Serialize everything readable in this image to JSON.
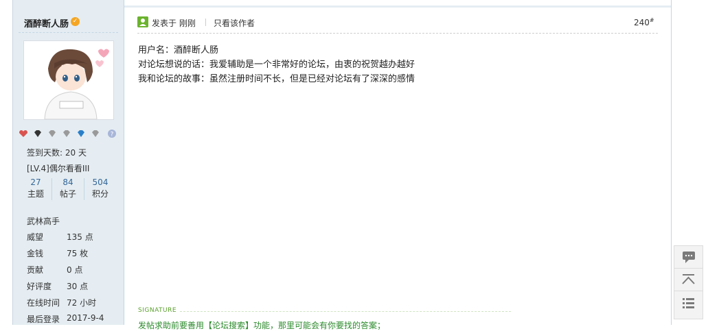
{
  "author": {
    "name": "酒醉断人肠",
    "signin_days": "签到天数: 20 天",
    "level": "[LV.4]偶尔看看III",
    "counts": [
      {
        "value": "27",
        "label": "主题"
      },
      {
        "value": "84",
        "label": "帖子"
      },
      {
        "value": "504",
        "label": "积分"
      }
    ],
    "rank": "武林高手",
    "info": [
      {
        "key": "威望",
        "value": "135 点"
      },
      {
        "key": "金钱",
        "value": "75 枚"
      },
      {
        "key": "贡献",
        "value": "0 点"
      },
      {
        "key": "好评度",
        "value": "30 点"
      },
      {
        "key": "在线时间",
        "value": "72 小时"
      },
      {
        "key": "最后登录",
        "value": "2017-9-4"
      }
    ],
    "medals": [
      "heart-medal-icon",
      "gem-medal-icon",
      "diamond-medal-icon",
      "diamond-medal-icon",
      "blue-gem-medal-icon",
      "diamond-medal-icon",
      "question-medal-icon"
    ]
  },
  "post": {
    "posted_prefix": "发表于",
    "posted_time": "刚刚",
    "only_author": "只看该作者",
    "floor": "240",
    "floor_sup": "#",
    "lines": [
      "用户名：酒醉断人肠",
      "对论坛想说的话：我爱辅助是一个非常好的论坛，由衷的祝贺越办越好",
      "我和论坛的故事：虽然注册时间不长，但是已经对论坛有了深深的感情"
    ],
    "signature_label": "SIGNATURE",
    "signature_text": "发帖求助前要善用【论坛搜索】功能，那里可能会有你要找的答案；"
  },
  "colors": {
    "sidebar_bg": "#e5edf2",
    "link_blue": "#336699",
    "signature_green": "#5aa02c"
  }
}
